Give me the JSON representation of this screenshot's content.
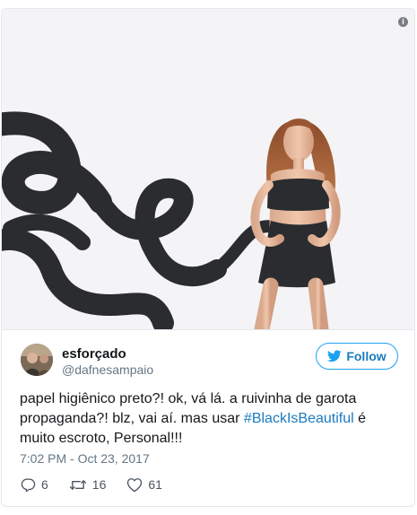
{
  "tweet": {
    "author_name": "esforçado",
    "author_handle": "@dafnesampaio",
    "follow_label": "Follow",
    "text_before": "papel higiênico preto?! ok, vá lá. a ruivinha de garota propaganda?! blz, vai aí. mas usar ",
    "hashtag": "#BlackIsBeautiful",
    "text_after": " é muito escroto, Personal!!!",
    "timestamp": "7:02 PM - Oct 23, 2017",
    "reply_count": "6",
    "retweet_count": "16",
    "like_count": "61"
  },
  "media": {
    "info_glyph": "i",
    "subject": "woman in black ribbon dress with flowing black ribbon",
    "background_color": "#f4f4f6",
    "ribbon_color": "#2a2c30"
  },
  "colors": {
    "accent": "#1da1f2",
    "link": "#1b7bbf",
    "muted": "#657786"
  },
  "icons": [
    "info-icon",
    "twitter-bird-icon",
    "reply-icon",
    "retweet-icon",
    "heart-icon"
  ]
}
